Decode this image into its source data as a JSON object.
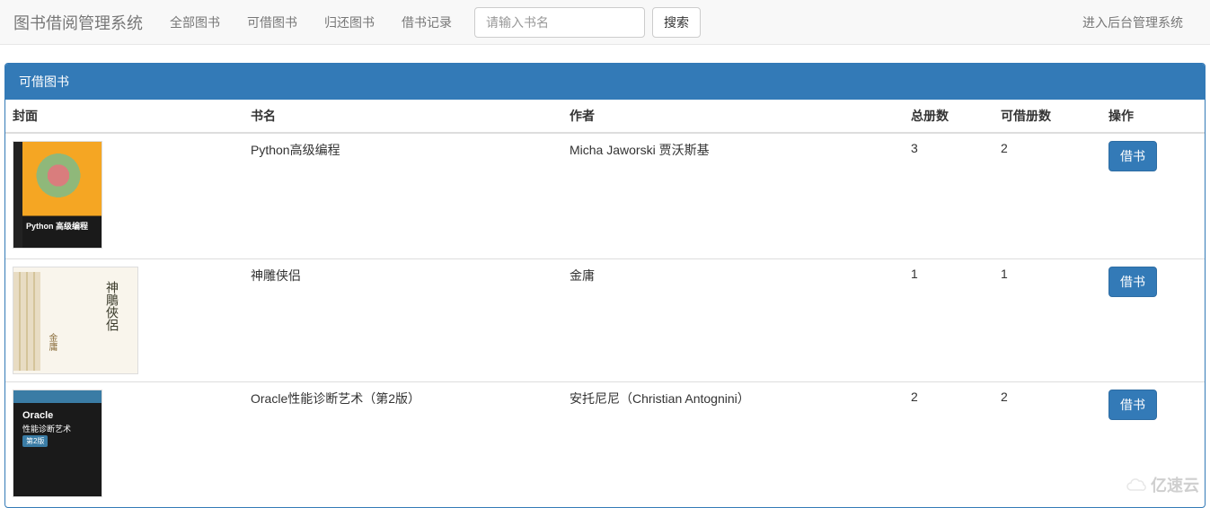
{
  "brand": "图书借阅管理系统",
  "nav": {
    "all_books": "全部图书",
    "available_books": "可借图书",
    "return_books": "归还图书",
    "borrow_records": "借书记录",
    "admin_link": "进入后台管理系统"
  },
  "search": {
    "placeholder": "请输入书名",
    "button": "搜索"
  },
  "panel": {
    "heading": "可借图书"
  },
  "table": {
    "headers": {
      "cover": "封面",
      "title": "书名",
      "author": "作者",
      "total": "总册数",
      "available": "可借册数",
      "action": "操作"
    },
    "rows": [
      {
        "title": "Python高级编程",
        "author": "Micha Jaworski 贾沃斯基",
        "total": "3",
        "available": "2",
        "action": "借书"
      },
      {
        "title": "神雕侠侣",
        "author": "金庸",
        "total": "1",
        "available": "1",
        "action": "借书"
      },
      {
        "title": "Oracle性能诊断艺术（第2版）",
        "author": "安托尼尼（Christian Antognini）",
        "total": "2",
        "available": "2",
        "action": "借书"
      }
    ]
  },
  "watermark": "亿速云"
}
